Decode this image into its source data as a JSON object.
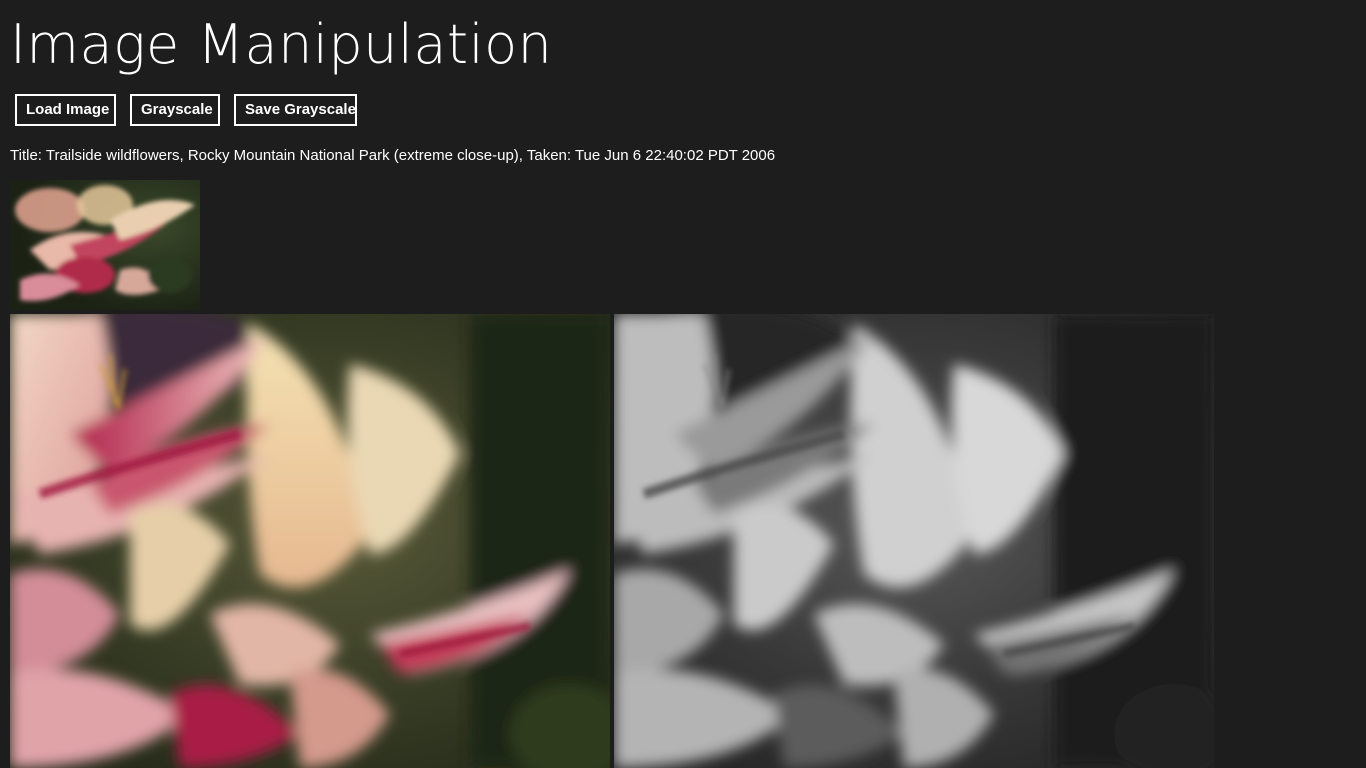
{
  "app": {
    "title": "Image Manipulation"
  },
  "toolbar": {
    "load_label": "Load Image",
    "grayscale_label": "Grayscale",
    "save_label": "Save Grayscale"
  },
  "image_info": {
    "text": "Title: Trailside wildflowers, Rocky Mountain National Park (extreme close-up), Taken: Tue Jun 6 22:40:02 PDT 2006"
  },
  "colors": {
    "background": "#1d1d1d",
    "text": "#ffffff",
    "button_border": "#ffffff"
  }
}
